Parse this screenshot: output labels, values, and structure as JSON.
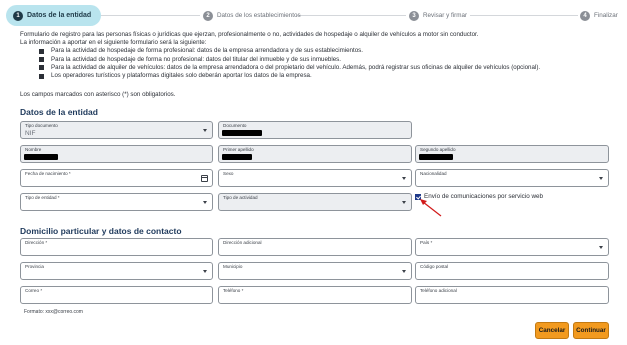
{
  "stepper": {
    "steps": [
      {
        "num": "1",
        "label": "Datos de la entidad"
      },
      {
        "num": "2",
        "label": "Datos de los establecimientos"
      },
      {
        "num": "3",
        "label": "Revisar y firmar"
      },
      {
        "num": "4",
        "label": "Finalizar"
      }
    ]
  },
  "intro": {
    "line1": "Formulario de registro para las personas físicas o jurídicas que ejerzan, profesionalmente o no, actividades de hospedaje o alquiler de vehículos a motor sin conductor.",
    "line2": "La información a aportar en el siguiente formulario será la siguiente:",
    "bullets": [
      "Para la actividad de hospedaje de forma profesional: datos de la empresa arrendadora y de sus establecimientos.",
      "Para la actividad de hospedaje de forma no profesional: datos del titular del inmueble y de sus inmuebles.",
      "Para la actividad de alquiler de vehículos: datos de la empresa arrendadora o del propietario del vehículo. Además, podrá registrar sus oficinas de alquiler de vehículos (opcional).",
      "Los operadores turísticos y plataformas digitales solo deberán aportar los datos de la empresa."
    ]
  },
  "note": "Los campos marcados con asterisco (*) son obligatorios.",
  "section1": {
    "title": "Datos de la entidad",
    "tipo_documento": {
      "label": "Tipo documento",
      "value": "NIF"
    },
    "documento": {
      "label": "Documento"
    },
    "nombre": {
      "label": "Nombre"
    },
    "primer_apellido": {
      "label": "Primer apellido"
    },
    "segundo_apellido": {
      "label": "Segundo apellido"
    },
    "fecha_nacimiento": {
      "label": "Fecha de nacimiento *"
    },
    "sexo": {
      "label": "Sexo"
    },
    "nacionalidad": {
      "label": "Nacionalidad"
    },
    "tipo_entidad": {
      "label": "Tipo de entidad *"
    },
    "tipo_actividad": {
      "label": "Tipo de actividad"
    },
    "envio": {
      "label": "Envío de comunicaciones por servicio web",
      "checked": true
    }
  },
  "section2": {
    "title": "Domicilio particular y datos de contacto",
    "direccion": {
      "label": "Dirección *"
    },
    "direccion_adicional": {
      "label": "Dirección adicional"
    },
    "pais": {
      "label": "País *"
    },
    "provincia": {
      "label": "Provincia"
    },
    "municipio": {
      "label": "Municipio"
    },
    "codigo_postal": {
      "label": "Código postal"
    },
    "correo": {
      "label": "Correo *"
    },
    "telefono": {
      "label": "Teléfono *"
    },
    "telefono_adicional": {
      "label": "Teléfono adicional"
    },
    "correo_hint": "Formato: xxx@correo.com"
  },
  "actions": {
    "cancel": "Cancelar",
    "continue": "Continuar"
  },
  "colors": {
    "accent": "#f29a1f",
    "active_step": "#b9e4ee",
    "title": "#1f3a5c",
    "annotation_arrow": "#d11a1a"
  }
}
